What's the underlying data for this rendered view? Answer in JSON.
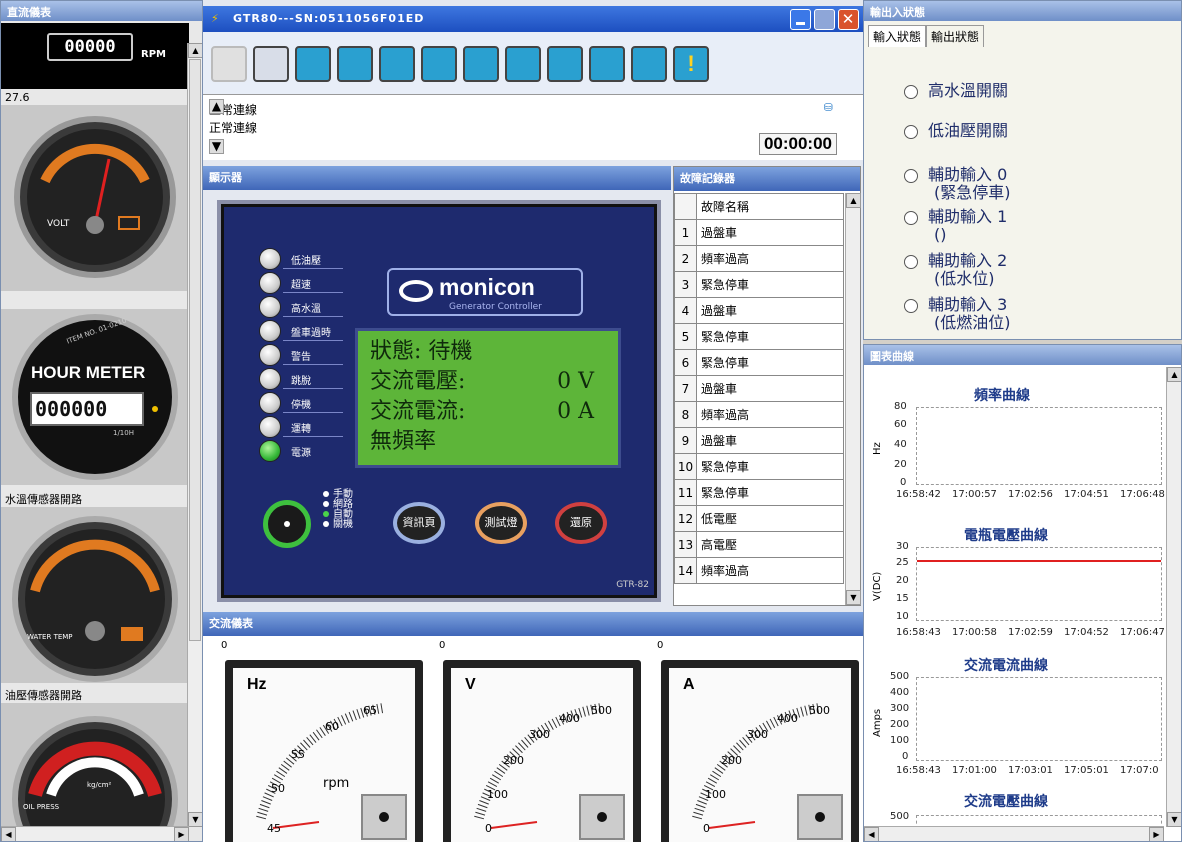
{
  "left_panel": {
    "title": "直流儀表",
    "rpm_value": "00000",
    "rpm_unit": "RPM",
    "volt_reading": "27.6",
    "volt_label": "VOLT",
    "hour_label": "HOUR METER",
    "hour_value": "000000",
    "hour_sub": "1/10H",
    "item_no": "ITEM NO. 01-0210",
    "water_caption": "水溫傳感器開路",
    "water_label": "WATER TEMP",
    "oil_caption": "油壓傳感器開路",
    "oil_label": "OIL PRESS",
    "oil_unit": "kg/cm²"
  },
  "window": {
    "title": "GTR80---SN:0511056F01ED",
    "status_lines": [
      "正常連線",
      "正常連線"
    ],
    "timer": "00:00:00"
  },
  "display": {
    "title": "顯示器",
    "leds": [
      "低油壓",
      "超速",
      "高水溫",
      "盤車過時",
      "警告",
      "跳脫",
      "停機",
      "運轉",
      "電源"
    ],
    "logo": "monicon",
    "logo_sub": "Generator Controller",
    "lcd": {
      "state": "狀態:  待機",
      "v_label": "交流電壓:",
      "v_value": "0 V",
      "a_label": "交流電流:",
      "a_value": "0 A",
      "freq": "無頻率"
    },
    "modes": [
      "手動",
      "網路",
      "自動",
      "關機"
    ],
    "buttons": [
      "資訊頁",
      "測試燈",
      "還原"
    ],
    "model": "GTR-82"
  },
  "fault_log": {
    "title": "故障記錄器",
    "header": "故障名稱",
    "rows": [
      "過盤車",
      "頻率過高",
      "緊急停車",
      "過盤車",
      "緊急停車",
      "緊急停車",
      "過盤車",
      "頻率過高",
      "過盤車",
      "緊急停車",
      "緊急停車",
      "低電壓",
      "高電壓",
      "頻率過高"
    ]
  },
  "ac_meters": {
    "title": "交流儀表",
    "zero": "0",
    "meters": [
      {
        "unit": "Hz",
        "ticks": [
          "45",
          "50",
          "55",
          "60",
          "65"
        ],
        "extra": "rpm"
      },
      {
        "unit": "V",
        "ticks": [
          "0",
          "100",
          "200",
          "300",
          "400",
          "500"
        ]
      },
      {
        "unit": "A",
        "ticks": [
          "0",
          "100",
          "200",
          "300",
          "400",
          "500"
        ]
      }
    ]
  },
  "io_status": {
    "title": "輸出入狀態",
    "tabs": [
      "輸入狀態",
      "輸出狀態"
    ],
    "inputs": [
      "高水溫開關",
      "低油壓開關",
      "輔助輸入 0",
      "(緊急停車)",
      "輔助輸入 1",
      "()",
      "輔助輸入 2",
      "(低水位)",
      "輔助輸入 3",
      "(低燃油位)"
    ]
  },
  "charts_panel": {
    "title": "圖表曲線",
    "charts": [
      {
        "title": "頻率曲線",
        "ylabel": "Hz",
        "yticks": [
          "80",
          "60",
          "40",
          "20",
          "0"
        ],
        "xticks": [
          "16:58:42",
          "17:00:57",
          "17:02:56",
          "17:04:51",
          "17:06:48"
        ]
      },
      {
        "title": "電瓶電壓曲線",
        "ylabel": "V(DC)",
        "yticks": [
          "30",
          "25",
          "20",
          "15",
          "10"
        ],
        "xticks": [
          "16:58:43",
          "17:00:58",
          "17:02:59",
          "17:04:52",
          "17:06:47"
        ]
      },
      {
        "title": "交流電流曲線",
        "ylabel": "Amps",
        "yticks": [
          "500",
          "400",
          "300",
          "200",
          "100",
          "0"
        ],
        "xticks": [
          "16:58:43",
          "17:01:00",
          "17:03:01",
          "17:05:01",
          "17:07:0"
        ]
      },
      {
        "title": "交流電壓曲線",
        "yticks": [
          "500"
        ]
      }
    ]
  },
  "colors": {
    "title_blue": "#2458c8",
    "lcd_green": "#5db539",
    "panel_navy": "#1e2a6e"
  }
}
